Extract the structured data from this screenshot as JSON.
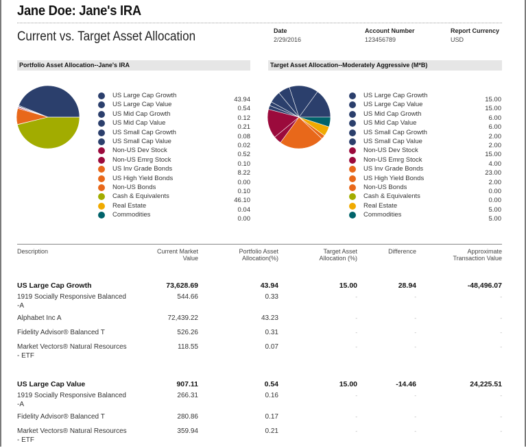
{
  "header": {
    "title": "Jane Doe: Jane's IRA",
    "subtitle": "Current vs. Target Asset Allocation",
    "meta": [
      {
        "label": "Date",
        "value": "2/29/2016"
      },
      {
        "label": "Account Number",
        "value": "123456789"
      },
      {
        "label": "Report Currency",
        "value": "USD"
      }
    ]
  },
  "colors": {
    "navy": "#2b3f6c",
    "crimson": "#9b0a3c",
    "orange": "#e8681a",
    "olive": "#a2ac00",
    "gold": "#f0aa00",
    "teal": "#00636a"
  },
  "chart_data": [
    {
      "type": "pie",
      "title": "Portfolio Asset Allocation--Jane's IRA",
      "categories": [
        "US Large Cap Growth",
        "US Large Cap Value",
        "US Mid Cap Growth",
        "US Mid Cap Value",
        "US Small Cap Growth",
        "US Small Cap Value",
        "Non-US Dev Stock",
        "Non-US Emrg Stock",
        "US Inv Grade Bonds",
        "US High Yield Bonds",
        "Non-US Bonds",
        "Cash & Equivalents",
        "Real Estate",
        "Commodities"
      ],
      "values": [
        43.94,
        0.54,
        0.12,
        0.21,
        0.08,
        0.02,
        0.52,
        0.1,
        8.22,
        0.0,
        0.1,
        46.1,
        0.04,
        0.0
      ],
      "labels": [
        "43.94",
        "0.54",
        "0.12",
        "0.21",
        "0.08",
        "0.02",
        "0.52",
        "0.10",
        "8.22",
        "0.00",
        "0.10",
        "46.10",
        "0.04",
        "0.00"
      ],
      "color_keys": [
        "navy",
        "navy",
        "navy",
        "navy",
        "navy",
        "navy",
        "crimson",
        "crimson",
        "orange",
        "orange",
        "orange",
        "olive",
        "gold",
        "teal"
      ]
    },
    {
      "type": "pie",
      "title": "Target Asset Allocation--Moderately Aggressive (M*B)",
      "categories": [
        "US Large Cap Growth",
        "US Large Cap Value",
        "US Mid Cap Growth",
        "US Mid Cap Value",
        "US Small Cap Growth",
        "US Small Cap Value",
        "Non-US Dev Stock",
        "Non-US Emrg Stock",
        "US Inv Grade Bonds",
        "US High Yield Bonds",
        "Non-US Bonds",
        "Cash & Equivalents",
        "Real Estate",
        "Commodities"
      ],
      "values": [
        15.0,
        15.0,
        6.0,
        6.0,
        2.0,
        2.0,
        15.0,
        4.0,
        23.0,
        2.0,
        0.0,
        0.0,
        5.0,
        5.0
      ],
      "labels": [
        "15.00",
        "15.00",
        "6.00",
        "6.00",
        "2.00",
        "2.00",
        "15.00",
        "4.00",
        "23.00",
        "2.00",
        "0.00",
        "0.00",
        "5.00",
        "5.00"
      ],
      "color_keys": [
        "navy",
        "navy",
        "navy",
        "navy",
        "navy",
        "navy",
        "crimson",
        "crimson",
        "orange",
        "orange",
        "orange",
        "olive",
        "gold",
        "teal"
      ]
    }
  ],
  "table": {
    "columns": [
      "Description",
      "Current Market Value",
      "Portfolio Asset Allocation(%)",
      "Target Asset Allocation (%)",
      "Difference",
      "Approximate Transaction Value"
    ],
    "column_lines": [
      [
        "Description",
        ""
      ],
      [
        "Current Market Value",
        ""
      ],
      [
        "Portfolio Asset",
        "Allocation(%)"
      ],
      [
        "Target Asset",
        "Allocation (%)"
      ],
      [
        "Difference",
        ""
      ],
      [
        "Approximate",
        "Transaction Value"
      ]
    ],
    "groups": [
      {
        "name": "US Large Cap Growth",
        "market_value": "73,628.69",
        "portfolio_pct": "43.94",
        "target_pct": "15.00",
        "difference": "28.94",
        "transaction": "-48,496.07",
        "holdings": [
          {
            "name": [
              "1919 Socially Responsive Balanced",
              "-A"
            ],
            "market_value": "544.66",
            "portfolio_pct": "0.33",
            "target_pct": "-",
            "difference": "-",
            "transaction": "-"
          },
          {
            "name": [
              "Alphabet Inc A"
            ],
            "market_value": "72,439.22",
            "portfolio_pct": "43.23",
            "target_pct": "-",
            "difference": "-",
            "transaction": "-"
          },
          {
            "name": [
              "Fidelity Advisor® Balanced T"
            ],
            "market_value": "526.26",
            "portfolio_pct": "0.31",
            "target_pct": "-",
            "difference": "-",
            "transaction": "-"
          },
          {
            "name": [
              "Market Vectors® Natural Resources",
              "- ETF"
            ],
            "market_value": "118.55",
            "portfolio_pct": "0.07",
            "target_pct": "-",
            "difference": "-",
            "transaction": "-"
          }
        ]
      },
      {
        "name": "US Large Cap Value",
        "market_value": "907.11",
        "portfolio_pct": "0.54",
        "target_pct": "15.00",
        "difference": "-14.46",
        "transaction": "24,225.51",
        "holdings": [
          {
            "name": [
              "1919 Socially Responsive Balanced",
              "-A"
            ],
            "market_value": "266.31",
            "portfolio_pct": "0.16",
            "target_pct": "-",
            "difference": "-",
            "transaction": "-"
          },
          {
            "name": [
              "Fidelity Advisor® Balanced T"
            ],
            "market_value": "280.86",
            "portfolio_pct": "0.17",
            "target_pct": "-",
            "difference": "-",
            "transaction": "-"
          },
          {
            "name": [
              "Market Vectors® Natural Resources",
              "- ETF"
            ],
            "market_value": "359.94",
            "portfolio_pct": "0.21",
            "target_pct": "-",
            "difference": "-",
            "transaction": "-"
          }
        ]
      }
    ]
  }
}
